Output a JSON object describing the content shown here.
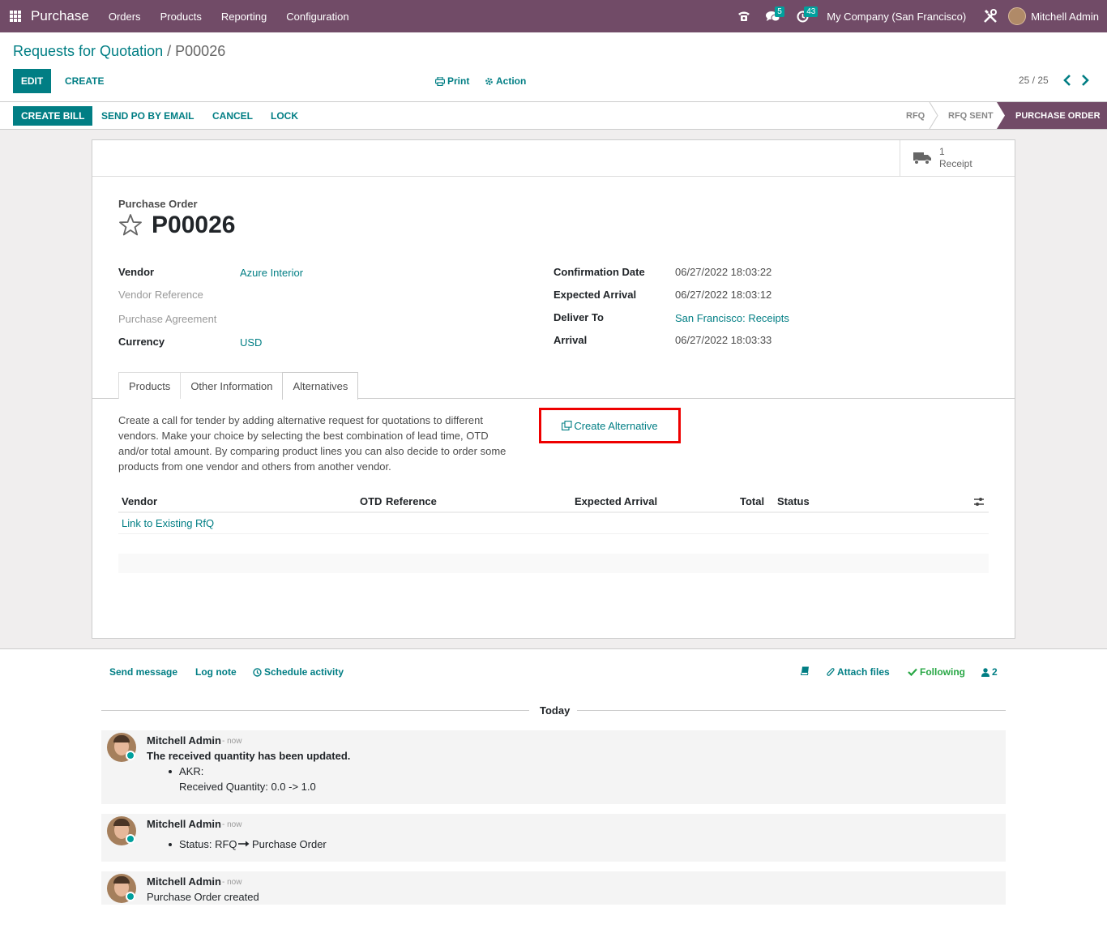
{
  "navbar": {
    "app_name": "Purchase",
    "menu": [
      "Orders",
      "Products",
      "Reporting",
      "Configuration"
    ],
    "messages_count": "5",
    "activities_count": "43",
    "company": "My Company (San Francisco)",
    "user": "Mitchell Admin",
    "colors": {
      "bar": "#714b67",
      "badge": "#00a09d"
    }
  },
  "breadcrumb": {
    "parent": "Requests for Quotation",
    "separator": "/",
    "current": "P00026"
  },
  "control": {
    "edit": "EDIT",
    "create": "CREATE",
    "print": "Print",
    "action": "Action",
    "pager": "25 / 25"
  },
  "statusbar": {
    "buttons": [
      "CREATE BILL",
      "SEND PO BY EMAIL",
      "CANCEL",
      "LOCK"
    ],
    "stages": [
      "RFQ",
      "RFQ SENT",
      "PURCHASE ORDER"
    ],
    "active_stage": "PURCHASE ORDER"
  },
  "smart_button": {
    "count": "1",
    "label": "Receipt",
    "icon": "truck-icon"
  },
  "form": {
    "title_label": "Purchase Order",
    "name": "P00026",
    "left_fields": [
      {
        "label": "Vendor",
        "value": "Azure Interior"
      },
      {
        "label": "Vendor Reference",
        "value": ""
      },
      {
        "label": "Purchase Agreement",
        "value": ""
      },
      {
        "label": "Currency",
        "value": "USD"
      }
    ],
    "right_fields": [
      {
        "label": "Confirmation Date",
        "value": "06/27/2022 18:03:22"
      },
      {
        "label": "Expected Arrival",
        "value": "06/27/2022 18:03:12"
      },
      {
        "label": "Deliver To",
        "value": "San Francisco: Receipts"
      },
      {
        "label": "Arrival",
        "value": "06/27/2022 18:03:33"
      }
    ]
  },
  "tabs": [
    "Products",
    "Other Information",
    "Alternatives"
  ],
  "active_tab": "Alternatives",
  "alternatives": {
    "description": "Create a call for tender by adding alternative request for quotations to different vendors. Make your choice by selecting the best combination of lead time, OTD and/or total amount. By comparing product lines you can also decide to order some products from one vendor and others from another vendor.",
    "create_button": "Create Alternative",
    "columns": [
      "Vendor",
      "OTD",
      "Reference",
      "Expected Arrival",
      "Total",
      "Status"
    ],
    "link_existing": "Link to Existing RfQ"
  },
  "chatter": {
    "send_message": "Send message",
    "log_note": "Log note",
    "schedule_activity": "Schedule activity",
    "attach_files": "Attach files",
    "following": "Following",
    "followers_count": "2",
    "date_separator": "Today",
    "messages": [
      {
        "author": "Mitchell Admin",
        "time": "- now",
        "title": "The received quantity has been updated.",
        "bullet": "AKR:",
        "detail": "Received Quantity: 0.0 -> 1.0"
      },
      {
        "author": "Mitchell Admin",
        "time": "- now",
        "status_prefix": "Status: RFQ",
        "status_suffix": "Purchase Order"
      },
      {
        "author": "Mitchell Admin",
        "time": "- now",
        "body": "Purchase Order created"
      }
    ]
  }
}
